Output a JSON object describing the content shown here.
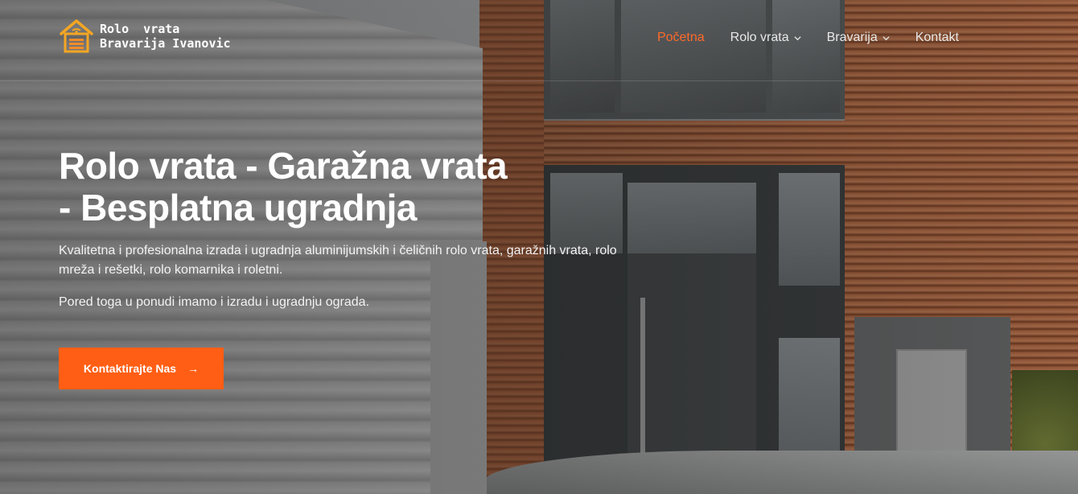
{
  "brand": {
    "line1": "Rolo  vrata",
    "line2": "Bravarija Ivanovic",
    "accent_color": "#ff5e14"
  },
  "nav": {
    "items": [
      {
        "label": "Početna",
        "active": true,
        "has_dropdown": false
      },
      {
        "label": "Rolo vrata",
        "active": false,
        "has_dropdown": true
      },
      {
        "label": "Bravarija",
        "active": false,
        "has_dropdown": true
      },
      {
        "label": "Kontakt",
        "active": false,
        "has_dropdown": false
      }
    ]
  },
  "hero": {
    "title_line1": "Rolo vrata - Garažna vrata",
    "title_line2": "- Besplatna ugradnja",
    "description": "Kvalitetna i profesionalna izrada i ugradnja aluminijumskih i čeličnih rolo vrata, garažnih vrata, rolo mreža i rešetki, rolo komarnika i roletni.",
    "description2": "Pored toga u ponudi imamo i izradu i ugradnju ograda.",
    "cta_label": "Kontaktirajte Nas",
    "cta_icon": "arrow-right-icon"
  }
}
